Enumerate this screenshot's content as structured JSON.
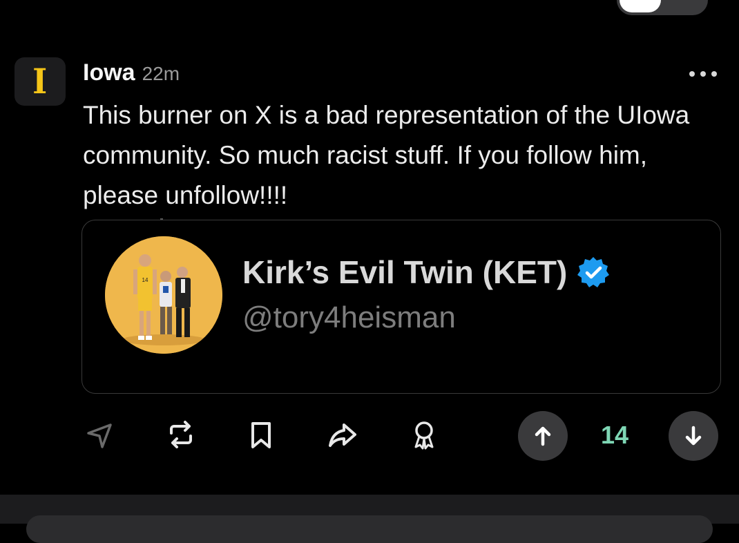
{
  "post": {
    "author": "Iowa",
    "avatar_letter": "I",
    "time": "22m",
    "body": "This burner on X is a bad representation of the UIowa community. So much racist stuff. If you follow him, please unfollow!!!!",
    "more_icon": "ellipsis-icon"
  },
  "embed": {
    "display_name": "Kirk’s Evil Twin (KET)",
    "handle": "@tory4heisman",
    "verified_icon": "verified-badge-icon",
    "badge_color": "#1d9bf0"
  },
  "actions": {
    "icons": [
      "send-icon",
      "repost-icon",
      "bookmark-icon",
      "share-icon",
      "award-icon"
    ],
    "upvote_icon": "arrow-up-icon",
    "downvote_icon": "arrow-down-icon",
    "score": "14",
    "score_color": "#7ed6b4"
  },
  "colors": {
    "background": "#000000",
    "accent": "#f5c518"
  }
}
